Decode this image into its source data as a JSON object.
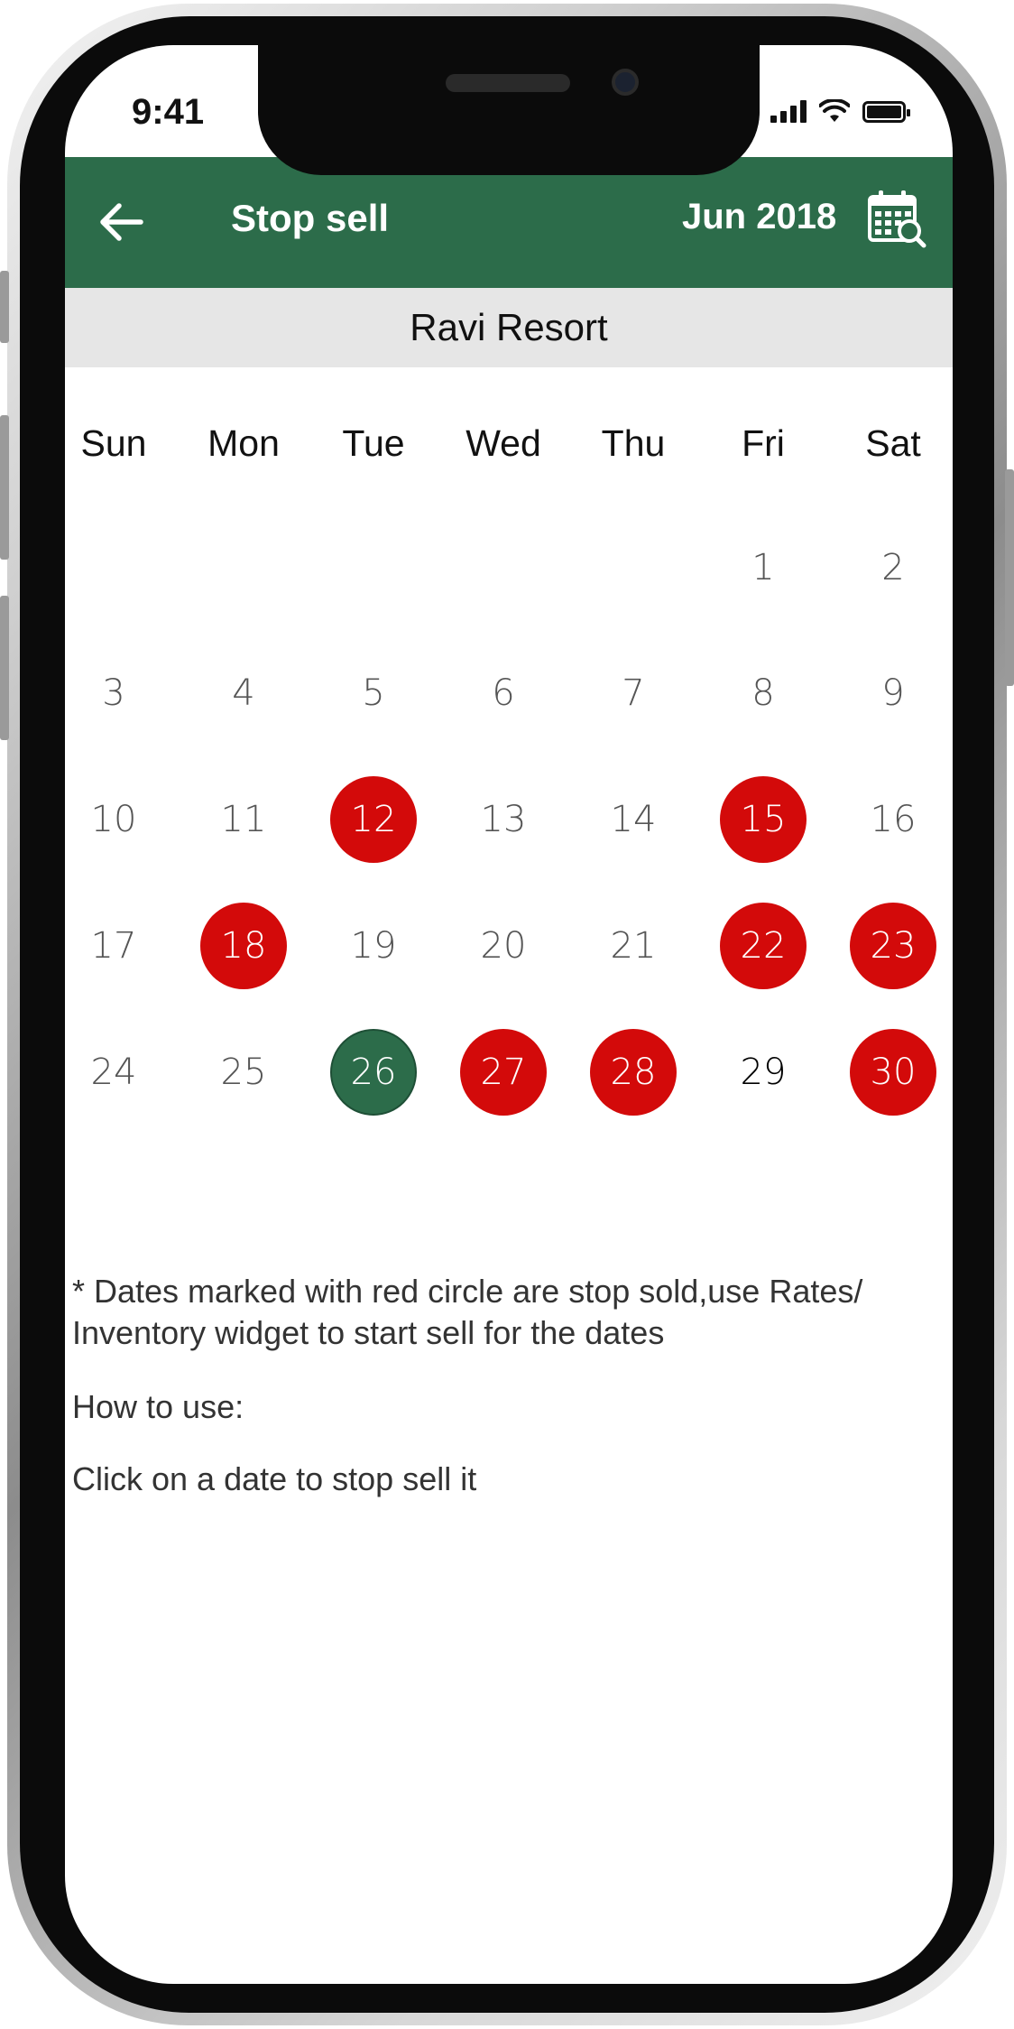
{
  "status_bar": {
    "time": "9:41"
  },
  "header": {
    "back_icon": "arrow-left-icon",
    "title": "Stop sell",
    "month": "Jun 2018",
    "calendar_icon": "calendar-search-icon"
  },
  "property": {
    "name": "Ravi Resort"
  },
  "colors": {
    "accent": "#2c6c4a",
    "stop_sold": "#d30a0a",
    "property_bar": "#e6e6e6"
  },
  "calendar": {
    "weekdays": [
      "Sun",
      "Mon",
      "Tue",
      "Wed",
      "Thu",
      "Fri",
      "Sat"
    ],
    "first_weekday_index": 5,
    "days_in_month": 30,
    "stop_sold_days": [
      12,
      15,
      18,
      22,
      23,
      27,
      28,
      30
    ],
    "selected_day": 26,
    "highlight_day": 29
  },
  "notes": {
    "info": "* Dates marked with red circle are stop sold,use Rates/ Inventory widget to start sell for the dates",
    "how_to_heading": "How to use:",
    "instruction": "Click on a date to stop sell it"
  }
}
